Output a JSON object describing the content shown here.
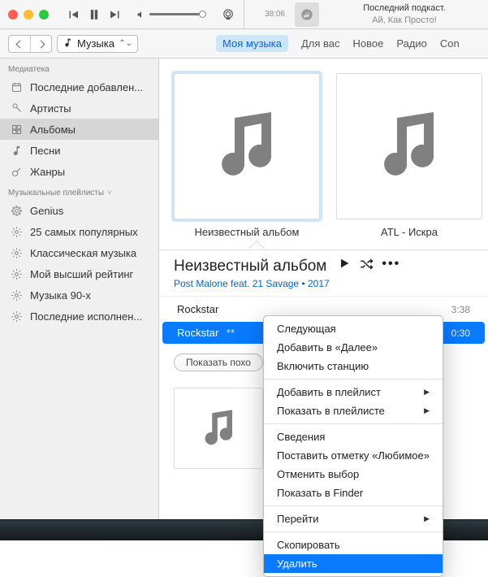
{
  "traffic": {
    "close": "close",
    "minimize": "minimize",
    "zoom": "zoom"
  },
  "transport": {
    "prev": "previous",
    "pause": "pause",
    "next": "next"
  },
  "now_playing": {
    "elapsed": "38:06",
    "title": "Последний подкаст.",
    "subtitle": "Ай, Как Просто!"
  },
  "nav": {
    "library_selector": "Музыка",
    "tabs": [
      "Моя музыка",
      "Для вас",
      "Новое",
      "Радио",
      "Con"
    ],
    "active_tab_index": 0
  },
  "sidebar": {
    "sections": [
      {
        "header": "Медиатека",
        "header_key": "library",
        "items": [
          {
            "icon": "clock",
            "label": "Последние добавлен..."
          },
          {
            "icon": "mic",
            "label": "Артисты"
          },
          {
            "icon": "grid",
            "label": "Альбомы",
            "selected": true
          },
          {
            "icon": "note",
            "label": "Песни"
          },
          {
            "icon": "guitar",
            "label": "Жанры"
          }
        ]
      },
      {
        "header": "Музыкальные плейлисты",
        "header_key": "playlists",
        "disclosure": true,
        "items": [
          {
            "icon": "genius",
            "label": "Genius"
          },
          {
            "icon": "gear",
            "label": "25 самых популярных"
          },
          {
            "icon": "gear",
            "label": "Классическая музыка"
          },
          {
            "icon": "gear",
            "label": "Мой высший рейтинг"
          },
          {
            "icon": "gear",
            "label": "Музыка 90-х"
          },
          {
            "icon": "gear",
            "label": "Последние исполнен..."
          }
        ]
      }
    ]
  },
  "albums": [
    {
      "title": "Неизвестный альбом",
      "selected": true
    },
    {
      "title": "ATL - Искра"
    }
  ],
  "album_detail": {
    "title": "Неизвестный альбом",
    "artist": "Post Malone feat. 21 Savage",
    "year": "2017",
    "tracks": [
      {
        "title": "Rockstar",
        "duration": "3:38"
      },
      {
        "title": "Rockstar",
        "duration": "0:30",
        "selected": true,
        "badge": "**"
      }
    ],
    "similar_btn": "Показать похо"
  },
  "context_menu": {
    "groups": [
      [
        {
          "label": "Следующая"
        },
        {
          "label": "Добавить в «Далее»"
        },
        {
          "label": "Включить станцию"
        }
      ],
      [
        {
          "label": "Добавить в плейлист",
          "submenu": true
        },
        {
          "label": "Показать в плейлисте",
          "submenu": true
        }
      ],
      [
        {
          "label": "Сведения"
        },
        {
          "label": "Поставить отметку «Любимое»"
        },
        {
          "label": "Отменить выбор"
        },
        {
          "label": "Показать в Finder"
        }
      ],
      [
        {
          "label": "Перейти",
          "submenu": true
        }
      ],
      [
        {
          "label": "Скопировать"
        },
        {
          "label": "Удалить",
          "highlight": true
        }
      ]
    ]
  }
}
